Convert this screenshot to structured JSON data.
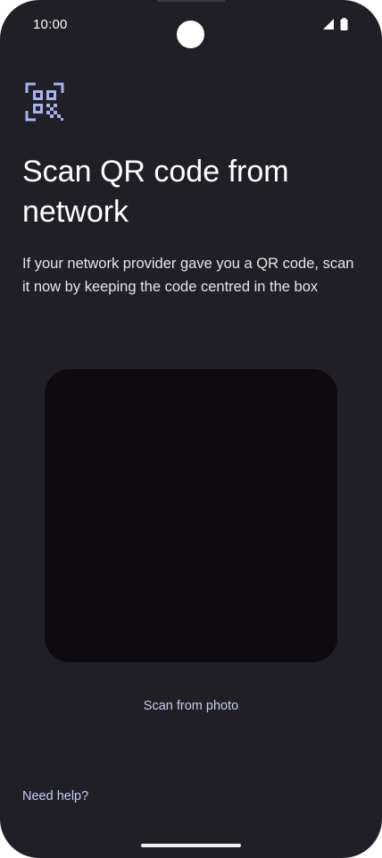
{
  "status_bar": {
    "time": "10:00",
    "icons": [
      "signal-icon",
      "battery-icon"
    ]
  },
  "page": {
    "header_icon": "qr-code-scan-icon",
    "title": "Scan QR code from network",
    "description": "If your network provider gave you a QR code, scan it now by keeping the code centred in the box",
    "scan_from_photo_label": "Scan from photo",
    "need_help_label": "Need help?"
  },
  "colors": {
    "background": "#1f1f25",
    "viewfinder": "#0e0a0f",
    "accent": "#c7cdf6",
    "icon": "#a9b1f0"
  }
}
